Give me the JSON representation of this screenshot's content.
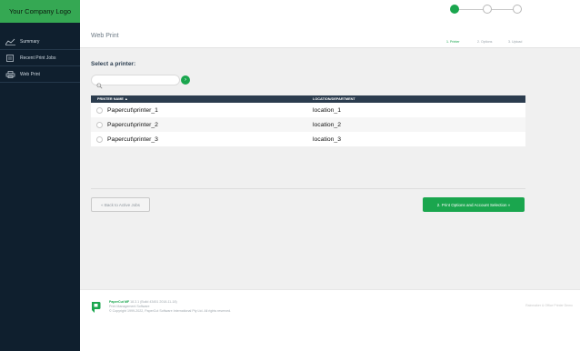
{
  "sidebar": {
    "logo_text": "Your Company Logo",
    "items": [
      {
        "label": "Summary",
        "icon": "chart-line-icon"
      },
      {
        "label": "Recent Print Jobs",
        "icon": "print-jobs-icon"
      },
      {
        "label": "Web Print",
        "icon": "printer-icon"
      }
    ]
  },
  "header": {
    "title": "Web Print",
    "steps": [
      {
        "label": "1. Printer",
        "active": true
      },
      {
        "label": "2. Options",
        "active": false
      },
      {
        "label": "3. Upload",
        "active": false
      }
    ]
  },
  "main": {
    "select_label": "Select a printer:",
    "search": {
      "value": "",
      "placeholder": ""
    },
    "go_label": "›",
    "table": {
      "headers": [
        "PRINTER NAME ▲",
        "LOCATION/DEPARTMENT"
      ],
      "rows": [
        {
          "name": "Papercut\\printer_1",
          "location": "location_1"
        },
        {
          "name": "Papercut\\printer_2",
          "location": "location_2"
        },
        {
          "name": "Papercut\\printer_3",
          "location": "location_3"
        }
      ]
    },
    "back_label": "« Back to Active Jobs",
    "next_label": "2. Print Options and Account Selection »"
  },
  "footer": {
    "product": "PaperCut MF",
    "version": "18.3.1 (Build 43451 2018-11-18)",
    "subtitle": "Print Management Software",
    "copyright": "© Copyright 1999-2022, PaperCut Software International Pty Ltd. All rights reserved.",
    "right_text": "Rainmaker & Office Printer Demo"
  },
  "colors": {
    "accent": "#1aa64e",
    "sidebar_bg": "#0f1f2e",
    "logo_bg": "#35a853",
    "table_header_bg": "#2b3c4e"
  }
}
